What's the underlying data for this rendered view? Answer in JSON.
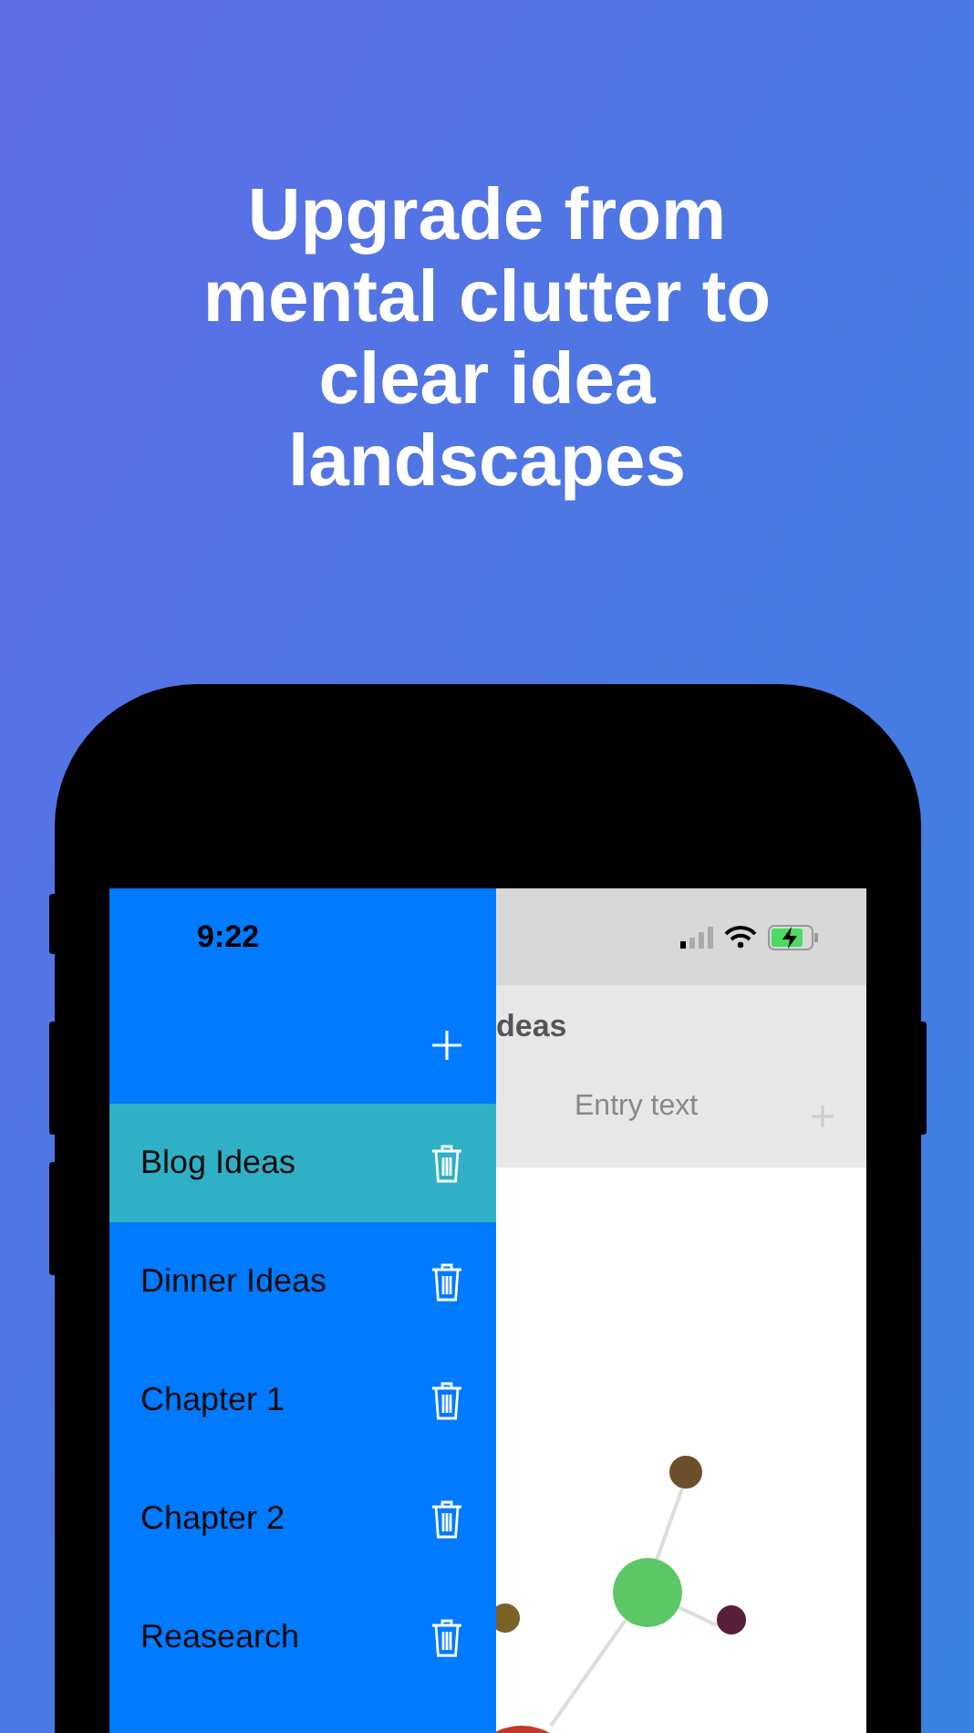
{
  "headline": "Upgrade from mental clutter to clear idea landscapes",
  "status_bar": {
    "time": "9:22"
  },
  "drawer": {
    "items": [
      {
        "label": "Blog Ideas",
        "selected": true
      },
      {
        "label": "Dinner Ideas",
        "selected": false
      },
      {
        "label": "Chapter 1",
        "selected": false
      },
      {
        "label": "Chapter 2",
        "selected": false
      },
      {
        "label": "Reasearch",
        "selected": false
      }
    ]
  },
  "background_screen": {
    "title": "deas",
    "entry": {
      "placeholder": "Entry text"
    }
  }
}
